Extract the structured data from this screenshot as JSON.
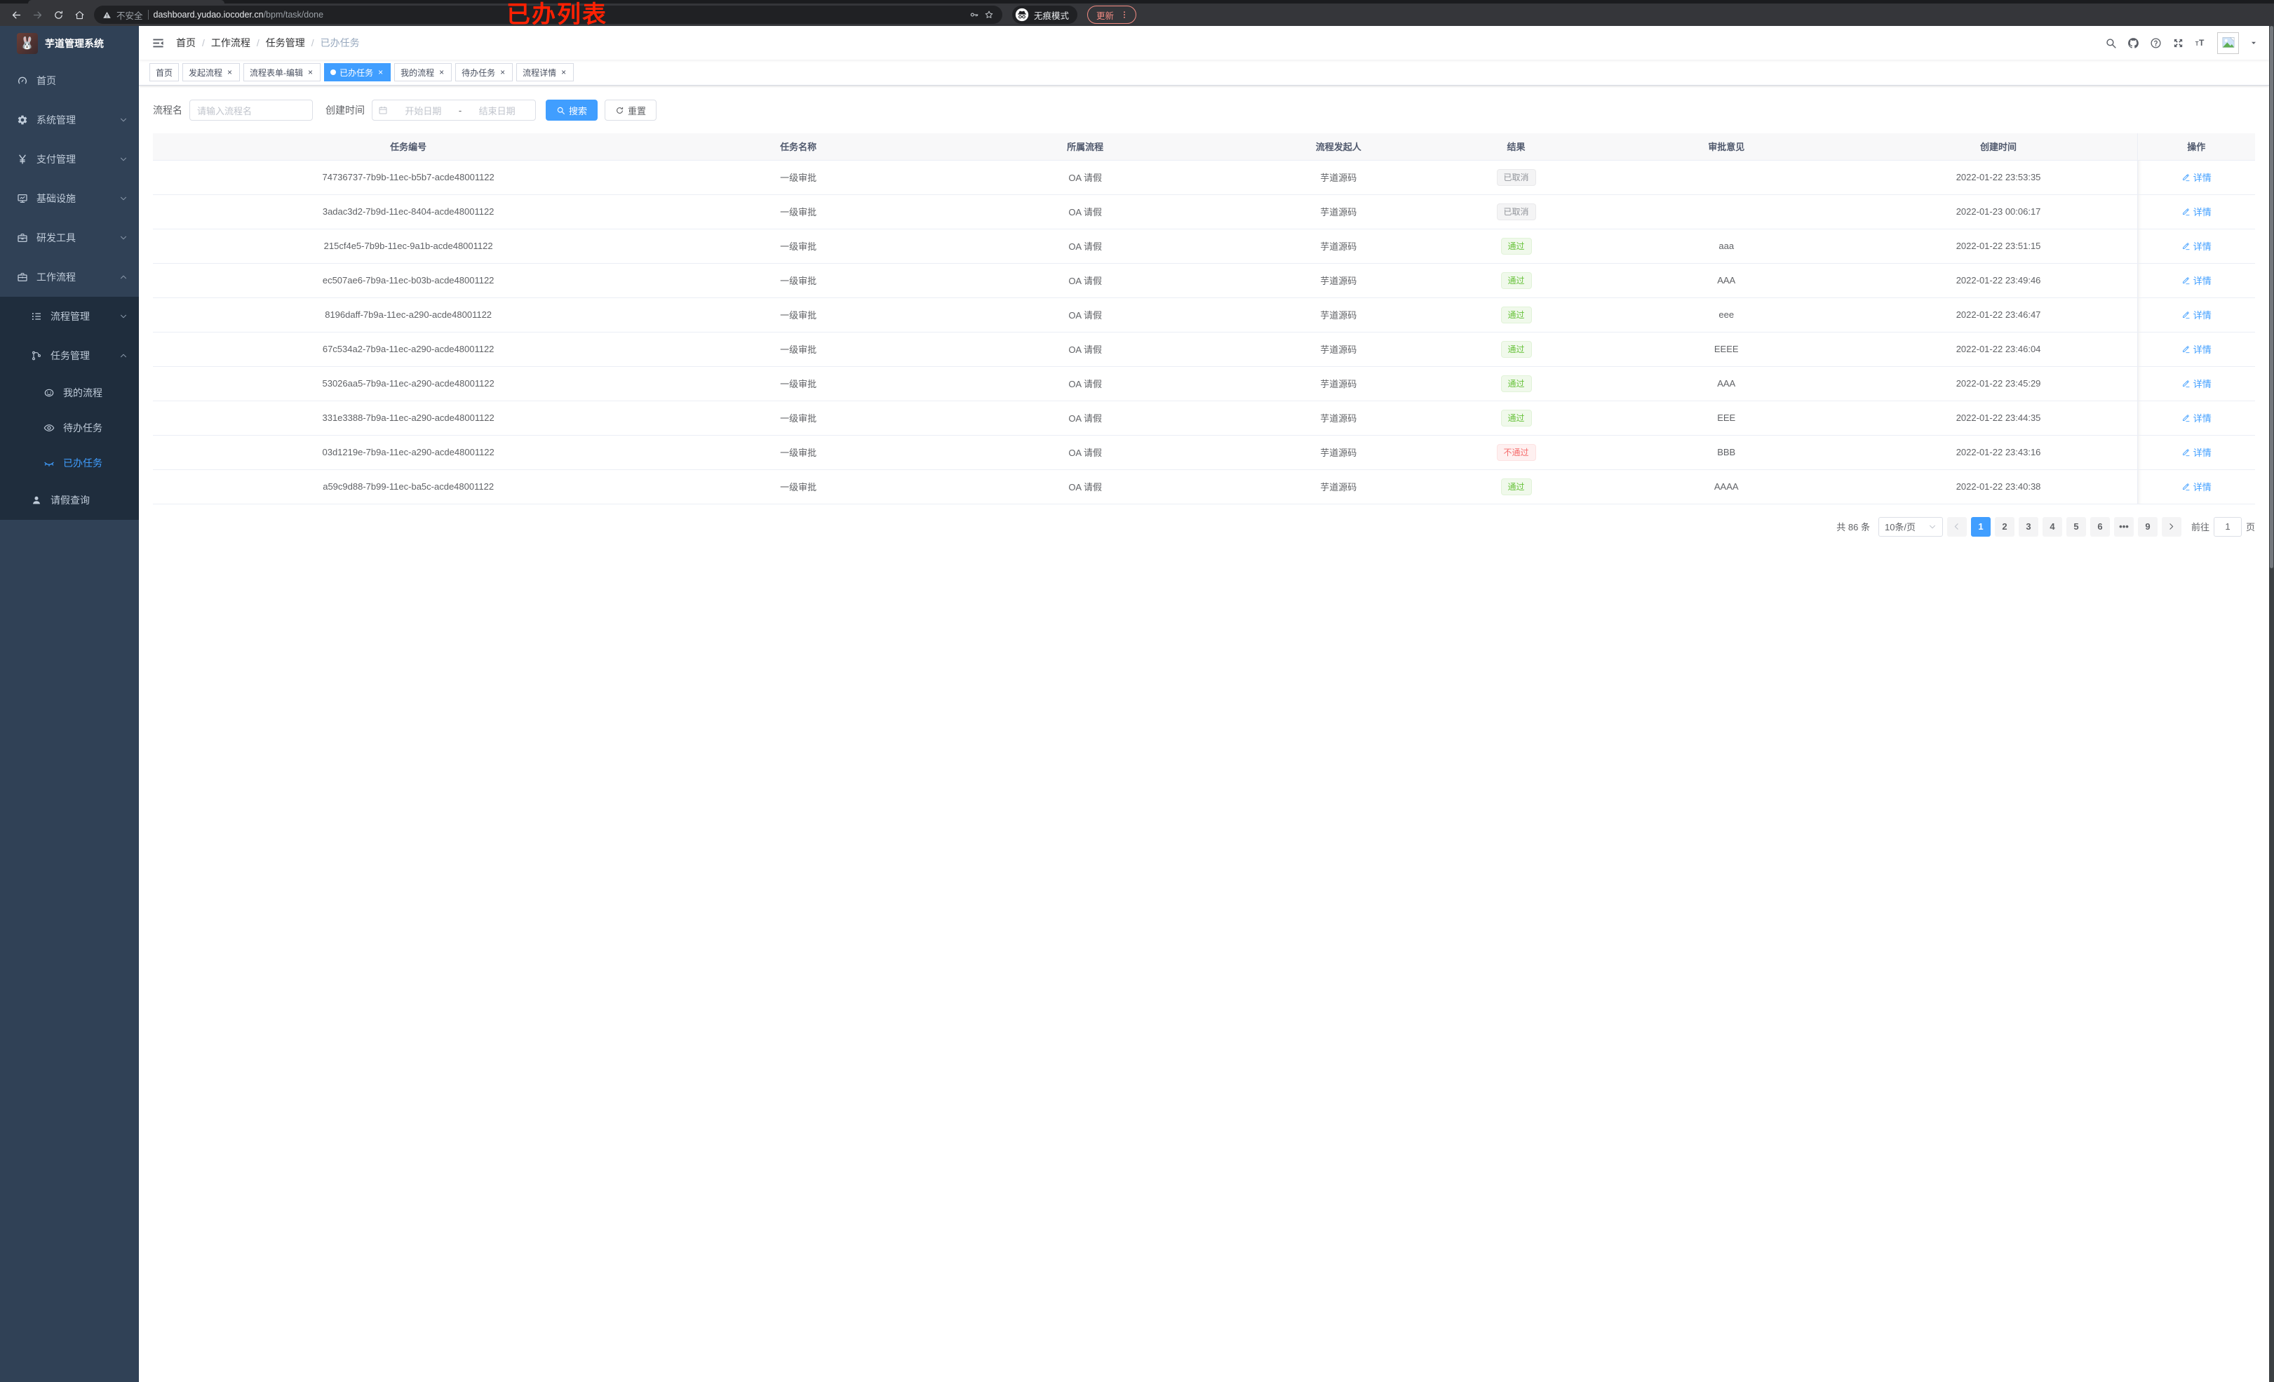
{
  "colors": {
    "accent": "#409eff",
    "success": "#67c23a",
    "danger": "#f56c6c",
    "info": "#909399",
    "sidebar_bg": "#304156",
    "submenu_bg": "#1f2d3d",
    "annotation_red": "#ff2103"
  },
  "annotation": {
    "text": "已办列表"
  },
  "browser": {
    "security_label": "不安全",
    "url_domain": "dashboard.yudao.iocoder.cn",
    "url_path": "/bpm/task/done",
    "incognito_label": "无痕模式",
    "update_label": "更新"
  },
  "sidebar": {
    "app_title": "芋道管理系统",
    "logo_icon": "rabbit-logo",
    "menu": [
      {
        "type": "item",
        "icon": "dashboard",
        "label": "首页",
        "level": 1
      },
      {
        "type": "submenu",
        "icon": "gear",
        "label": "系统管理",
        "state": "collapsed",
        "level": 1
      },
      {
        "type": "submenu",
        "icon": "yen",
        "label": "支付管理",
        "state": "collapsed",
        "level": 1
      },
      {
        "type": "submenu",
        "icon": "monitor",
        "label": "基础设施",
        "state": "collapsed",
        "level": 1
      },
      {
        "type": "submenu",
        "icon": "toolbox",
        "label": "研发工具",
        "state": "collapsed",
        "level": 1
      },
      {
        "type": "submenu",
        "icon": "briefcase",
        "label": "工作流程",
        "state": "expanded",
        "level": 1,
        "children": [
          {
            "type": "submenu",
            "icon": "list",
            "label": "流程管理",
            "state": "collapsed",
            "level": 2
          },
          {
            "type": "submenu",
            "icon": "flow",
            "label": "任务管理",
            "state": "expanded",
            "level": 2,
            "children": [
              {
                "type": "item",
                "icon": "face",
                "label": "我的流程",
                "level": 3
              },
              {
                "type": "item",
                "icon": "eye",
                "label": "待办任务",
                "level": 3
              },
              {
                "type": "item",
                "icon": "eye-closed",
                "label": "已办任务",
                "level": 3,
                "active": true
              }
            ]
          },
          {
            "type": "item",
            "icon": "user",
            "label": "请假查询",
            "level": 2
          }
        ]
      }
    ]
  },
  "breadcrumb": [
    "首页",
    "工作流程",
    "任务管理",
    "已办任务"
  ],
  "navbar_icons": [
    {
      "name": "search-icon",
      "icon": "magnifier"
    },
    {
      "name": "github-icon",
      "icon": "github"
    },
    {
      "name": "help-icon",
      "icon": "question"
    },
    {
      "name": "fullscreen-icon",
      "icon": "fullscreen"
    },
    {
      "name": "font-size-icon",
      "icon": "fontsize"
    }
  ],
  "tabs": [
    {
      "label": "首页",
      "closable": false,
      "active": false
    },
    {
      "label": "发起流程",
      "closable": true,
      "active": false
    },
    {
      "label": "流程表单-编辑",
      "closable": true,
      "active": false
    },
    {
      "label": "已办任务",
      "closable": true,
      "active": true
    },
    {
      "label": "我的流程",
      "closable": true,
      "active": false
    },
    {
      "label": "待办任务",
      "closable": true,
      "active": false
    },
    {
      "label": "流程详情",
      "closable": true,
      "active": false
    }
  ],
  "filters": {
    "name_label": "流程名",
    "name_placeholder": "请输入流程名",
    "time_label": "创建时间",
    "start_placeholder": "开始日期",
    "range_separator": "-",
    "end_placeholder": "结束日期",
    "search_label": "搜索",
    "reset_label": "重置"
  },
  "table": {
    "columns": [
      "任务编号",
      "任务名称",
      "所属流程",
      "流程发起人",
      "结果",
      "审批意见",
      "创建时间",
      "操作"
    ],
    "action_label": "详情",
    "rows": [
      {
        "id": "74736737-7b9b-11ec-b5b7-acde48001122",
        "name": "一级审批",
        "process": "OA 请假",
        "starter": "芋道源码",
        "result": "已取消",
        "result_type": "info",
        "opinion": "",
        "created": "2022-01-22 23:53:35"
      },
      {
        "id": "3adac3d2-7b9d-11ec-8404-acde48001122",
        "name": "一级审批",
        "process": "OA 请假",
        "starter": "芋道源码",
        "result": "已取消",
        "result_type": "info",
        "opinion": "",
        "created": "2022-01-23 00:06:17"
      },
      {
        "id": "215cf4e5-7b9b-11ec-9a1b-acde48001122",
        "name": "一级审批",
        "process": "OA 请假",
        "starter": "芋道源码",
        "result": "通过",
        "result_type": "success",
        "opinion": "aaa",
        "created": "2022-01-22 23:51:15"
      },
      {
        "id": "ec507ae6-7b9a-11ec-b03b-acde48001122",
        "name": "一级审批",
        "process": "OA 请假",
        "starter": "芋道源码",
        "result": "通过",
        "result_type": "success",
        "opinion": "AAA",
        "created": "2022-01-22 23:49:46"
      },
      {
        "id": "8196daff-7b9a-11ec-a290-acde48001122",
        "name": "一级审批",
        "process": "OA 请假",
        "starter": "芋道源码",
        "result": "通过",
        "result_type": "success",
        "opinion": "eee",
        "created": "2022-01-22 23:46:47"
      },
      {
        "id": "67c534a2-7b9a-11ec-a290-acde48001122",
        "name": "一级审批",
        "process": "OA 请假",
        "starter": "芋道源码",
        "result": "通过",
        "result_type": "success",
        "opinion": "EEEE",
        "created": "2022-01-22 23:46:04"
      },
      {
        "id": "53026aa5-7b9a-11ec-a290-acde48001122",
        "name": "一级审批",
        "process": "OA 请假",
        "starter": "芋道源码",
        "result": "通过",
        "result_type": "success",
        "opinion": "AAA",
        "created": "2022-01-22 23:45:29"
      },
      {
        "id": "331e3388-7b9a-11ec-a290-acde48001122",
        "name": "一级审批",
        "process": "OA 请假",
        "starter": "芋道源码",
        "result": "通过",
        "result_type": "success",
        "opinion": "EEE",
        "created": "2022-01-22 23:44:35"
      },
      {
        "id": "03d1219e-7b9a-11ec-a290-acde48001122",
        "name": "一级审批",
        "process": "OA 请假",
        "starter": "芋道源码",
        "result": "不通过",
        "result_type": "danger",
        "opinion": "BBB",
        "created": "2022-01-22 23:43:16"
      },
      {
        "id": "a59c9d88-7b99-11ec-ba5c-acde48001122",
        "name": "一级审批",
        "process": "OA 请假",
        "starter": "芋道源码",
        "result": "通过",
        "result_type": "success",
        "opinion": "AAAA",
        "created": "2022-01-22 23:40:38"
      }
    ]
  },
  "pagination": {
    "total_label": "共 86 条",
    "page_size": "10条/页",
    "pages": [
      "1",
      "2",
      "3",
      "4",
      "5",
      "6",
      "•••",
      "9"
    ],
    "active_page": "1",
    "goto_label": "前往",
    "goto_value": "1",
    "goto_suffix": "页"
  }
}
